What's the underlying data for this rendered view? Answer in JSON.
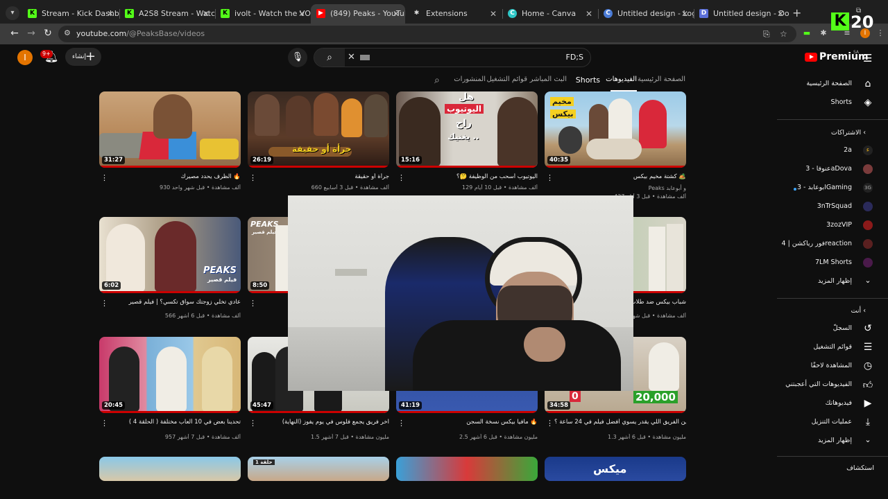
{
  "browser": {
    "tabs": [
      {
        "title": "Stream - Kick Dashboard",
        "icon": "kick-icon"
      },
      {
        "title": "A2S8 Stream - Watch Live",
        "icon": "kick-icon"
      },
      {
        "title": "ivolt - Watch the VOD on",
        "icon": "kick-icon"
      },
      {
        "title": "(849) Peaks - YouTube",
        "icon": "youtube-icon"
      },
      {
        "title": "Extensions",
        "icon": "puzzle-icon"
      },
      {
        "title": "Home - Canva",
        "icon": "canva-icon"
      },
      {
        "title": "Untitled design - Logo",
        "icon": "canva-icon"
      },
      {
        "title": "Untitled design - Doc",
        "icon": "canva-doc-icon"
      }
    ],
    "url_host": "youtube.com",
    "url_path": "/@PeaksBase/videos",
    "profile_initial": "I"
  },
  "overlay": {
    "badge_count": "20",
    "logo_letter": "K"
  },
  "header": {
    "brand": "Premium",
    "region": "SA",
    "search_value": "FD;S",
    "create_label": "إنشاء",
    "notif_count": "9+",
    "avatar_initial": "I"
  },
  "channel_tabs": [
    {
      "label": "الصفحة الرئيسية",
      "active": false
    },
    {
      "label": "الفيديوهات",
      "active": true
    },
    {
      "label": "Shorts",
      "active": false
    },
    {
      "label": "البث المباشر",
      "active": false
    },
    {
      "label": "قوائم التشغيل",
      "active": false
    },
    {
      "label": "المنشورات",
      "active": false
    }
  ],
  "sidebar": {
    "top": [
      {
        "label": "الصفحة الرئيسية",
        "icon": "home-icon"
      },
      {
        "label": "Shorts",
        "icon": "shorts-icon"
      }
    ],
    "subs_title": "الاشتراكات",
    "subscriptions": [
      {
        "label": "2a",
        "color": "#d4a017"
      },
      {
        "label": "عنوفا - 3aDova",
        "color": "#7a3b3b"
      },
      {
        "label": "ابوعابد - 3Gaming",
        "color": "#333333"
      },
      {
        "label": "3nTrSquad",
        "color": "#2a2a5a"
      },
      {
        "label": "3zozVIP",
        "color": "#8b1a1a"
      },
      {
        "label": "فور رياكشن | 4reaction",
        "color": "#5a2020"
      },
      {
        "label": "7LM Shorts",
        "color": "#4a1a4a"
      }
    ],
    "subs_more": "إظهار المزيد",
    "you_title": "أنت",
    "you_items": [
      {
        "label": "السجلّ",
        "icon": "history-icon"
      },
      {
        "label": "قوائم التشغيل",
        "icon": "playlist-icon"
      },
      {
        "label": "المشاهدة لاحقًا",
        "icon": "clock-icon"
      },
      {
        "label": "الفيديوهات التي أعجبتني",
        "icon": "thumbs-up-icon"
      },
      {
        "label": "فيديوهاتك",
        "icon": "video-icon"
      },
      {
        "label": "عمليات التنزيل",
        "icon": "download-icon"
      }
    ],
    "you_more": "إظهار المزيد",
    "explore_title": "استكشاف"
  },
  "videos": [
    {
      "title": "الظرف يحدد مصيرك 🔥",
      "meta": "930 ألف مشاهدة • قبل شهر واحد",
      "duration": "31:27",
      "channel": ""
    },
    {
      "title": "جرأة أو حقيقة",
      "meta": "660 ألف مشاهدة • قبل 3 أسابيع",
      "duration": "26:19",
      "channel": ""
    },
    {
      "title": "اليوتيوب أسحب من الوظيفة 🤔؟",
      "meta": "129 ألف مشاهدة • قبل 10 أيام",
      "duration": "15:16",
      "channel": ""
    },
    {
      "title": "كشتة مخيم بيكس 🏕️",
      "meta": "437 ألف مشاهدة • قبل 3 أيام",
      "duration": "40:35",
      "channel": "Peaks و أبوعابد"
    },
    {
      "title": "عادي تخلي زوجتك سواق تكسي؟ | فيلم قصير",
      "meta": "566 ألف مشاهدة • قبل 6 أشهر",
      "duration": "6:02",
      "channel": ""
    },
    {
      "title": "",
      "meta": "",
      "duration": "8:50",
      "channel": ""
    },
    {
      "title": "",
      "meta": "",
      "duration": "",
      "channel": ""
    },
    {
      "title": "شباب بيكس ضد طلاب ابتدائي",
      "meta": "786 ألف مشاهدة • قبل شهر",
      "duration": "",
      "channel": ""
    },
    {
      "title": "تحدينا بعض في 10 ألعاب مختلفة ( الحلقة 4 )",
      "meta": "957 ألف مشاهدة • قبل 7 أشهر",
      "duration": "20:45",
      "channel": ""
    },
    {
      "title": "آخر فريق يجمع فلوس في يوم يفوز (النهاية)",
      "meta": "1.5 مليون مشاهدة • قبل 7 أشهر",
      "duration": "45:47",
      "channel": ""
    },
    {
      "title": "مافيا بيكس نسخة السجن 🔥",
      "meta": "2.5 مليون مشاهدة • قبل 6 أشهر",
      "duration": "41:19",
      "channel": ""
    },
    {
      "title": "مين الفريق اللي يقدر يسوي أفضل فيلم في 24 ساعة ؟",
      "meta": "1.3 مليون مشاهدة • قبل 6 أشهر",
      "duration": "34:58",
      "channel": ""
    }
  ],
  "thumb_texts": {
    "v2": "جرأة أو حقيقة",
    "v3a": "هل",
    "v3b": "اليوتيوب",
    "v3c": "راح",
    "v3d": "يغنيك ..",
    "v4a": "مخيم",
    "v4b": "بيكس",
    "v5a": "PEAKS",
    "v5b": "فيلم قصير",
    "v6a": "PEAKS",
    "v6b": "فيلم قصير",
    "v12a": "20,000",
    "v12b": "0",
    "r4a": "حلقة 1",
    "r4b": "ميكس"
  }
}
